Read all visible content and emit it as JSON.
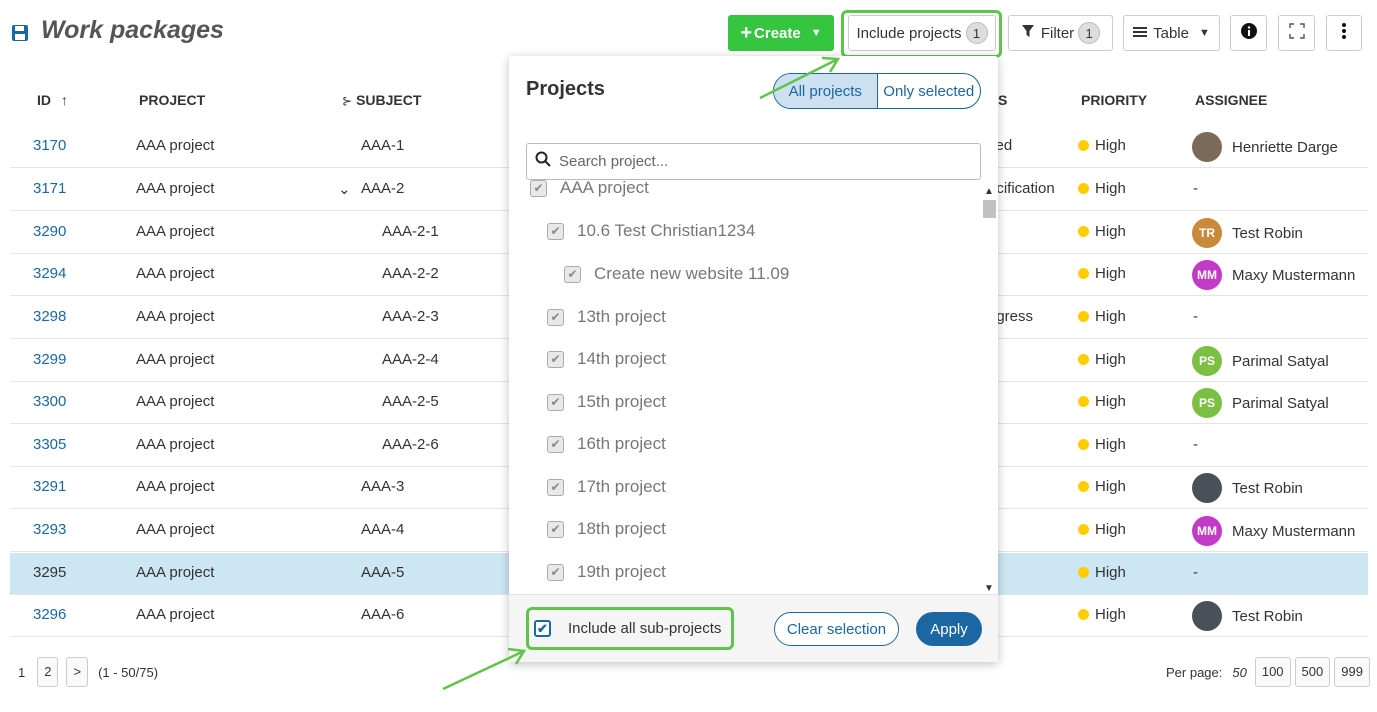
{
  "header": {
    "title": "Work packages",
    "create_label": "Create",
    "include_projects_label": "Include projects",
    "include_projects_count": "1",
    "filter_label": "Filter",
    "filter_count": "1",
    "table_label": "Table"
  },
  "columns": {
    "id": "ID",
    "project": "PROJECT",
    "subject": "SUBJECT",
    "status_partial": "S",
    "priority": "PRIORITY",
    "assignee": "ASSIGNEE"
  },
  "rows": [
    {
      "id": "3170",
      "project": "AAA project",
      "subject": "AAA-1",
      "status": "fied",
      "priority": "High",
      "assignee": "Henriette Darge",
      "avatar_type": "photo"
    },
    {
      "id": "3171",
      "project": "AAA project",
      "subject": "AAA-2",
      "status": "ecification",
      "priority": "High",
      "assignee": "-",
      "avatar_type": "none"
    },
    {
      "id": "3290",
      "project": "AAA project",
      "subject": "AAA-2-1",
      "status": "",
      "priority": "High",
      "assignee": "Test Robin",
      "avatar_type": "initials",
      "initials": "TR",
      "avatar_color": "#c98a3a"
    },
    {
      "id": "3294",
      "project": "AAA project",
      "subject": "AAA-2-2",
      "status": "",
      "priority": "High",
      "assignee": "Maxy Mustermann",
      "avatar_type": "initials",
      "initials": "MM",
      "avatar_color": "#c33bc4"
    },
    {
      "id": "3298",
      "project": "AAA project",
      "subject": "AAA-2-3",
      "status": "ogress",
      "priority": "High",
      "assignee": "-",
      "avatar_type": "none"
    },
    {
      "id": "3299",
      "project": "AAA project",
      "subject": "AAA-2-4",
      "status": "",
      "priority": "High",
      "assignee": "Parimal Satyal",
      "avatar_type": "initials",
      "initials": "PS",
      "avatar_color": "#7bc043"
    },
    {
      "id": "3300",
      "project": "AAA project",
      "subject": "AAA-2-5",
      "status": "",
      "priority": "High",
      "assignee": "Parimal Satyal",
      "avatar_type": "initials",
      "initials": "PS",
      "avatar_color": "#7bc043"
    },
    {
      "id": "3305",
      "project": "AAA project",
      "subject": "AAA-2-6",
      "status": "",
      "priority": "High",
      "assignee": "-",
      "avatar_type": "none"
    },
    {
      "id": "3291",
      "project": "AAA project",
      "subject": "AAA-3",
      "status": "",
      "priority": "High",
      "assignee": "Test Robin",
      "avatar_type": "photo"
    },
    {
      "id": "3293",
      "project": "AAA project",
      "subject": "AAA-4",
      "status": "",
      "priority": "High",
      "assignee": "Maxy Mustermann",
      "avatar_type": "initials",
      "initials": "MM",
      "avatar_color": "#c33bc4"
    },
    {
      "id": "3295",
      "project": "AAA project",
      "subject": "AAA-5",
      "status": "",
      "priority": "High",
      "assignee": "-",
      "avatar_type": "none",
      "selected": true
    },
    {
      "id": "3296",
      "project": "AAA project",
      "subject": "AAA-6",
      "status": "",
      "priority": "High",
      "assignee": "Test Robin",
      "avatar_type": "photo"
    }
  ],
  "pagination": {
    "page1": "1",
    "page2": "2",
    "next": ">",
    "range": "(1 - 50/75)",
    "per_page_label": "Per page:",
    "per_page_options": [
      "50",
      "100",
      "500",
      "999"
    ]
  },
  "projects_dropdown": {
    "title": "Projects",
    "all_projects": "All projects",
    "only_selected": "Only selected",
    "search_placeholder": "Search project...",
    "items": [
      {
        "name": "AAA project",
        "level": 0
      },
      {
        "name": "10.6 Test Christian1234",
        "level": 1
      },
      {
        "name": "Create new website 11.09",
        "level": 2
      },
      {
        "name": "13th project",
        "level": 1
      },
      {
        "name": "14th project",
        "level": 1
      },
      {
        "name": "15th project",
        "level": 1
      },
      {
        "name": "16th project",
        "level": 1
      },
      {
        "name": "17th project",
        "level": 1
      },
      {
        "name": "18th project",
        "level": 1
      },
      {
        "name": "19th project",
        "level": 1
      }
    ],
    "include_subprojects": "Include all sub-projects",
    "clear_selection": "Clear selection",
    "apply": "Apply"
  },
  "colors": {
    "accent_green": "#35c53f",
    "highlight_green": "#5ec44a",
    "link_blue": "#1a67a3",
    "selected_row": "#cce6f4",
    "priority_high": "#ffcc00"
  }
}
